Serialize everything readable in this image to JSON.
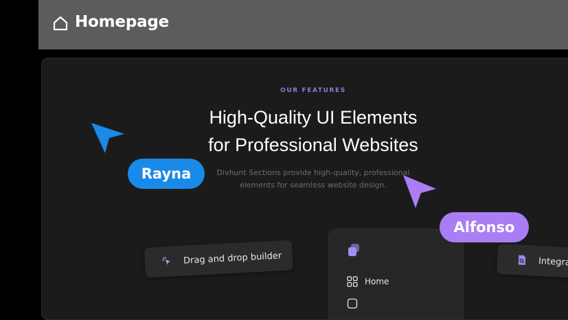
{
  "topbar": {
    "icon": "home-icon",
    "title": "Homepage"
  },
  "hero": {
    "eyebrow": "OUR FEATURES",
    "headline_line1": "High-Quality UI Elements",
    "headline_line2": "for Professional Websites",
    "subtext_line1": "Divhunt Sections provide high-quality, professional",
    "subtext_line2": "elements for seamless website design."
  },
  "collaborators": [
    {
      "name": "Rayna",
      "color": "#1a8ae8"
    },
    {
      "name": "Alfonso",
      "color": "#a97ef5"
    }
  ],
  "feature_chips": [
    {
      "label": "Drag and drop builder",
      "icon": "pointer-click-icon"
    },
    {
      "label": "Integra",
      "icon": "document-search-icon"
    }
  ],
  "panel": {
    "items": [
      {
        "label": "Home",
        "icon": "grid-icon"
      },
      {
        "label": "",
        "icon": "square-icon"
      }
    ]
  },
  "colors": {
    "accent": "#8d7ad9",
    "background": "#1b1b1b",
    "topbar": "#5c5c5c"
  }
}
